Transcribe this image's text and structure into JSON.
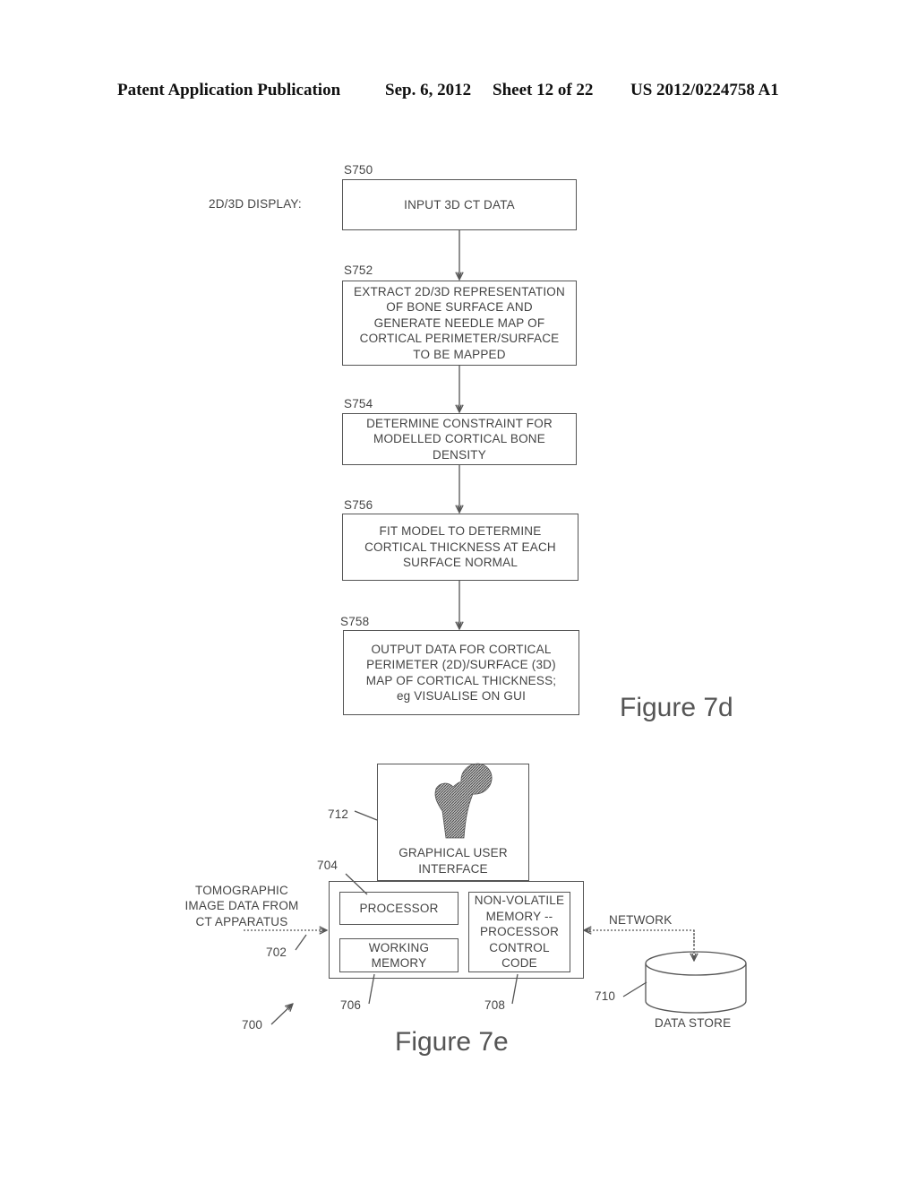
{
  "header": {
    "publication": "Patent Application Publication",
    "date": "Sep. 6, 2012",
    "sheet": "Sheet 12 of 22",
    "number": "US 2012/0224758 A1"
  },
  "figure_7d": {
    "caption": "Figure 7d",
    "side_label": "2D/3D DISPLAY:",
    "steps": [
      {
        "id": "S750",
        "text": "INPUT 3D CT DATA"
      },
      {
        "id": "S752",
        "text": "EXTRACT 2D/3D REPRESENTATION\nOF BONE SURFACE AND\nGENERATE NEEDLE MAP OF\nCORTICAL PERIMETER/SURFACE\nTO BE MAPPED"
      },
      {
        "id": "S754",
        "text": "DETERMINE CONSTRAINT FOR\nMODELLED CORTICAL BONE\nDENSITY"
      },
      {
        "id": "S756",
        "text": "FIT MODEL TO DETERMINE\nCORTICAL THICKNESS AT EACH\nSURFACE NORMAL"
      },
      {
        "id": "S758",
        "text": "OUTPUT DATA FOR CORTICAL\nPERIMETER (2D)/SURFACE (3D)\nMAP OF CORTICAL THICKNESS;\neg VISUALISE ON GUI"
      }
    ]
  },
  "figure_7e": {
    "caption": "Figure 7e",
    "gui": {
      "ref": "712",
      "text": "GRAPHICAL USER\nINTERFACE",
      "icon": "femur-bone-icon"
    },
    "processor": {
      "ref": "704",
      "text": "PROCESSOR"
    },
    "working_memory": {
      "ref": "706",
      "text": "WORKING\nMEMORY"
    },
    "nonvolatile": {
      "ref": "708",
      "text": "NON-VOLATILE\nMEMORY --\nPROCESSOR\nCONTROL\nCODE"
    },
    "input": {
      "ref": "702",
      "text": "TOMOGRAPHIC\nIMAGE DATA FROM\nCT APPARATUS"
    },
    "network_label": "NETWORK",
    "data_store": {
      "ref": "710",
      "text": "DATA STORE"
    },
    "system_ref": "700"
  }
}
